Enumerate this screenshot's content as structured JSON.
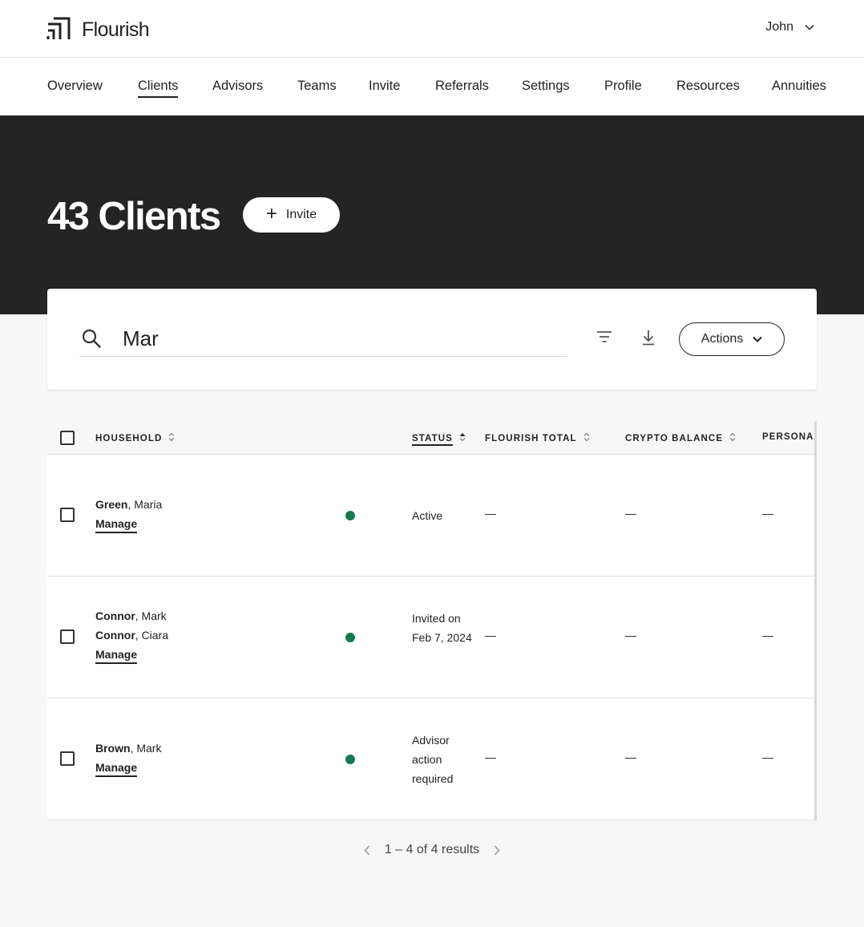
{
  "header": {
    "brand": "Flourish",
    "user_name": "John",
    "logo_icon": "flourish-logo-icon",
    "user_menu_icon": "chevron-down-icon"
  },
  "nav": {
    "items": [
      {
        "label": "Overview",
        "active": false
      },
      {
        "label": "Clients",
        "active": true
      },
      {
        "label": "Advisors",
        "active": false
      },
      {
        "label": "Teams",
        "active": false
      },
      {
        "label": "Invite",
        "active": false
      },
      {
        "label": "Referrals",
        "active": false
      },
      {
        "label": "Settings",
        "active": false
      },
      {
        "label": "Profile",
        "active": false
      },
      {
        "label": "Resources",
        "active": false
      },
      {
        "label": "Annuities",
        "active": false
      }
    ]
  },
  "hero": {
    "title": "43 Clients",
    "invite_label": "Invite",
    "invite_icon": "plus-icon"
  },
  "search": {
    "value": "Mar",
    "placeholder": "",
    "search_icon": "search-icon",
    "filter_icon": "filter-icon",
    "download_icon": "download-icon",
    "actions_label": "Actions"
  },
  "table": {
    "columns": [
      {
        "key": "household",
        "label": "HOUSEHOLD",
        "sorted": false
      },
      {
        "key": "status",
        "label": "STATUS",
        "sorted": true
      },
      {
        "key": "flourish_total",
        "label": "FLOURISH TOTAL",
        "sorted": false
      },
      {
        "key": "crypto_balance",
        "label": "CRYPTO BALANCE",
        "sorted": false
      },
      {
        "key": "personal",
        "label": "PERSONAL",
        "sorted": false
      }
    ],
    "rows": [
      {
        "members": [
          {
            "last": "Green",
            "first": "Maria"
          }
        ],
        "manage_label": "Manage",
        "status_dot_color": "#147a52",
        "status": "Active",
        "flourish_total": "—",
        "crypto_balance": "—",
        "personal": "—"
      },
      {
        "members": [
          {
            "last": "Connor",
            "first": "Mark"
          },
          {
            "last": "Connor",
            "first": "Ciara"
          }
        ],
        "manage_label": "Manage",
        "status_dot_color": "#147a52",
        "status": "Invited on Feb 7, 2024",
        "flourish_total": "—",
        "crypto_balance": "—",
        "personal": "—"
      },
      {
        "members": [
          {
            "last": "Brown",
            "first": "Mark"
          }
        ],
        "manage_label": "Manage",
        "status_dot_color": "#147a52",
        "status": "Advisor action required",
        "flourish_total": "—",
        "crypto_balance": "—",
        "personal": "—"
      }
    ]
  },
  "pagination": {
    "text": "1 – 4 of 4 results"
  },
  "colors": {
    "hero_bg": "#242424",
    "page_bg": "#f7f7f7",
    "status_active": "#147a52"
  }
}
